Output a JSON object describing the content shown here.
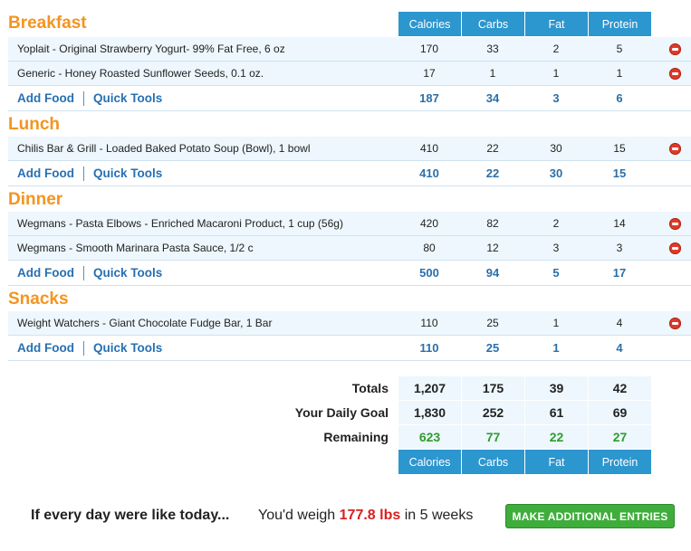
{
  "columns": [
    "Calories",
    "Carbs",
    "Fat",
    "Protein"
  ],
  "actions": {
    "add_food": "Add Food",
    "quick_tools": "Quick Tools"
  },
  "meals": [
    {
      "name": "Breakfast",
      "foods": [
        {
          "name": "Yoplait - Original Strawberry Yogurt- 99% Fat Free, 6 oz",
          "calories": "170",
          "carbs": "33",
          "fat": "2",
          "protein": "5"
        },
        {
          "name": "Generic - Honey Roasted Sunflower Seeds, 0.1 oz.",
          "calories": "17",
          "carbs": "1",
          "fat": "1",
          "protein": "1"
        }
      ],
      "totals": {
        "calories": "187",
        "carbs": "34",
        "fat": "3",
        "protein": "6"
      }
    },
    {
      "name": "Lunch",
      "foods": [
        {
          "name": "Chilis Bar & Grill - Loaded Baked Potato Soup (Bowl), 1 bowl",
          "calories": "410",
          "carbs": "22",
          "fat": "30",
          "protein": "15"
        }
      ],
      "totals": {
        "calories": "410",
        "carbs": "22",
        "fat": "30",
        "protein": "15"
      }
    },
    {
      "name": "Dinner",
      "foods": [
        {
          "name": "Wegmans - Pasta Elbows - Enriched Macaroni Product, 1 cup (56g)",
          "calories": "420",
          "carbs": "82",
          "fat": "2",
          "protein": "14"
        },
        {
          "name": "Wegmans - Smooth Marinara Pasta Sauce, 1/2 c",
          "calories": "80",
          "carbs": "12",
          "fat": "3",
          "protein": "3"
        }
      ],
      "totals": {
        "calories": "500",
        "carbs": "94",
        "fat": "5",
        "protein": "17"
      }
    },
    {
      "name": "Snacks",
      "foods": [
        {
          "name": "Weight Watchers - Giant Chocolate Fudge Bar, 1 Bar",
          "calories": "110",
          "carbs": "25",
          "fat": "1",
          "protein": "4"
        }
      ],
      "totals": {
        "calories": "110",
        "carbs": "25",
        "fat": "1",
        "protein": "4"
      }
    }
  ],
  "summary": {
    "totals": {
      "label": "Totals",
      "calories": "1,207",
      "carbs": "175",
      "fat": "39",
      "protein": "42"
    },
    "goal": {
      "label": "Your Daily Goal",
      "calories": "1,830",
      "carbs": "252",
      "fat": "61",
      "protein": "69"
    },
    "remaining": {
      "label": "Remaining",
      "calories": "623",
      "carbs": "77",
      "fat": "22",
      "protein": "27"
    }
  },
  "projection": {
    "lead": "If every day were like today...",
    "prefix": "You'd weigh",
    "weight": "177.8 lbs",
    "suffix": "in 5 weeks",
    "button": "MAKE ADDITIONAL ENTRIES"
  },
  "colors": {
    "accent_orange": "#f4941f",
    "header_blue": "#2c96cf",
    "link_blue": "#2770b2",
    "remaining_green": "#2e9c2e",
    "weight_red": "#d92020",
    "button_green": "#3fad3b"
  }
}
